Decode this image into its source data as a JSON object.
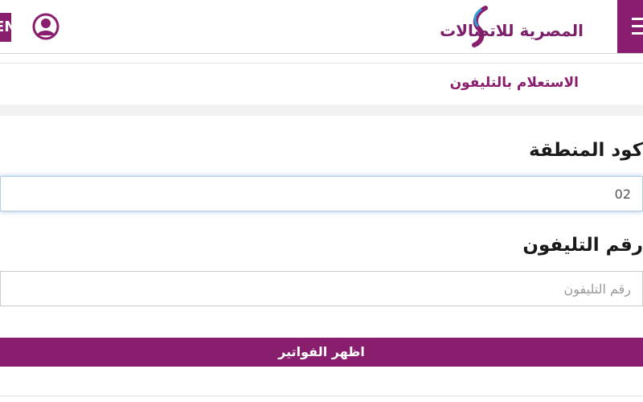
{
  "header": {
    "language_label": "EN",
    "logo_text": "المصرية للاتصالات",
    "menu_icon": "hamburger-menu-icon",
    "avatar_icon": "user-avatar-icon"
  },
  "breadcrumb": {
    "title": "الاستعلام بالتليفون"
  },
  "form": {
    "area_code_label": "كود المنطقة",
    "area_code_value": "02",
    "phone_label": "رقم التليفون",
    "phone_placeholder": "رقم التليفون",
    "submit_label": "اظهر الفواتير"
  },
  "colors": {
    "brand": "#8a1e6e",
    "text": "#1a1a1a"
  }
}
